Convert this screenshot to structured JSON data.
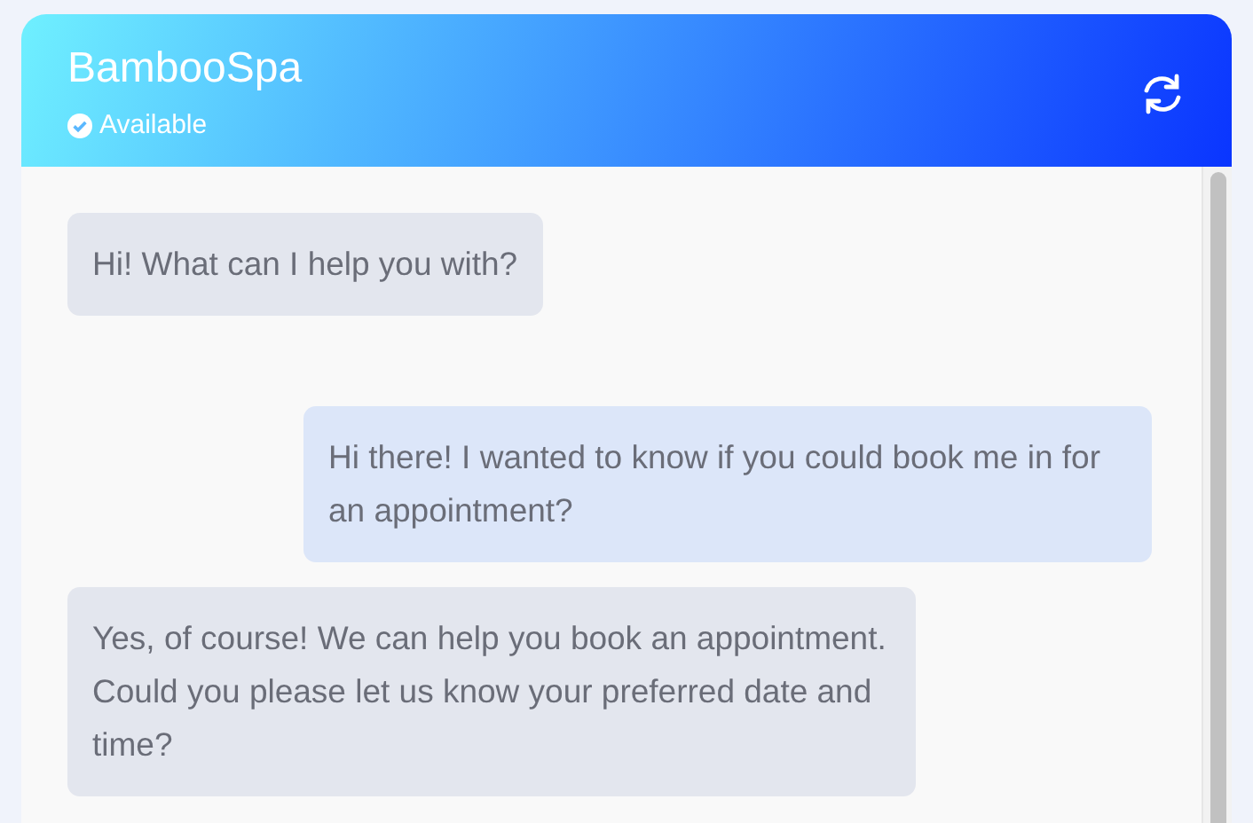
{
  "header": {
    "title": "BambooSpa",
    "status": "Available"
  },
  "messages": [
    {
      "kind": "bot",
      "text": "Hi! What can I help you with?"
    },
    {
      "kind": "user",
      "text": "Hi there! I wanted to know if you could book me in for an appointment?"
    },
    {
      "kind": "bot",
      "text": "Yes, of course! We can help you book an appointment. Could you please let us know your preferred date and time?"
    }
  ]
}
